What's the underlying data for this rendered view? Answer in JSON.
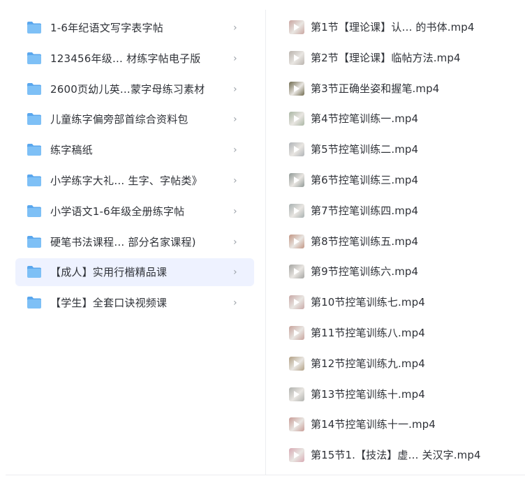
{
  "folders": [
    {
      "label": "1-6年纪语文写字表字帖",
      "selected": false
    },
    {
      "label": "123456年级…  材练字帖电子版",
      "selected": false
    },
    {
      "label": "2600页幼儿英…蒙字母练习素材",
      "selected": false
    },
    {
      "label": " 儿童练字偏旁部首综合资料包",
      "selected": false
    },
    {
      "label": "练字稿纸",
      "selected": false
    },
    {
      "label": "小学练字大礼…  生字、字帖类》",
      "selected": false
    },
    {
      "label": "小学语文1-6年级全册练字帖",
      "selected": false
    },
    {
      "label": "硬笔书法课程…  部分名家课程)",
      "selected": false
    },
    {
      "label": "【成人】实用行楷精品课",
      "selected": true
    },
    {
      "label": "【学生】全套口诀视频课",
      "selected": false
    }
  ],
  "chevron_glyph": "›",
  "files": [
    {
      "label": "第1节【理论课】认…  的书体.mp4",
      "thumb": "#c9a5a0"
    },
    {
      "label": "第2节【理论课】临帖方法.mp4",
      "thumb": "#b9b3ad"
    },
    {
      "label": "第3节正确坐姿和握笔.mp4",
      "thumb": "#6f6a4e"
    },
    {
      "label": "第4节控笔训练一.mp4",
      "thumb": "#a9b6a3"
    },
    {
      "label": "第5节控笔训练二.mp4",
      "thumb": "#aeb2b6"
    },
    {
      "label": "第6节控笔训练三.mp4",
      "thumb": "#8f9895"
    },
    {
      "label": "第7节控笔训练四.mp4",
      "thumb": "#a7b0b0"
    },
    {
      "label": "第8节控笔训练五.mp4",
      "thumb": "#c29583"
    },
    {
      "label": "第9节控笔训练六.mp4",
      "thumb": "#a3a3a0"
    },
    {
      "label": "第10节控笔训练七.mp4",
      "thumb": "#c8a8a6"
    },
    {
      "label": "第11节控笔训练八.mp4",
      "thumb": "#c7a29b"
    },
    {
      "label": "第12节控笔训练九.mp4",
      "thumb": "#b1a084"
    },
    {
      "label": "第13节控笔训练十.mp4",
      "thumb": "#b0b1ad"
    },
    {
      "label": "第14节控笔训练十一.mp4",
      "thumb": "#c89b95"
    },
    {
      "label": "第15节1.【技法】虚…  关汉字.mp4",
      "thumb": "#d7a9b3"
    }
  ],
  "colors": {
    "folder_body": "#7ec0f6",
    "folder_tab": "#5aa7ee",
    "selected_bg": "#eef2ff"
  }
}
